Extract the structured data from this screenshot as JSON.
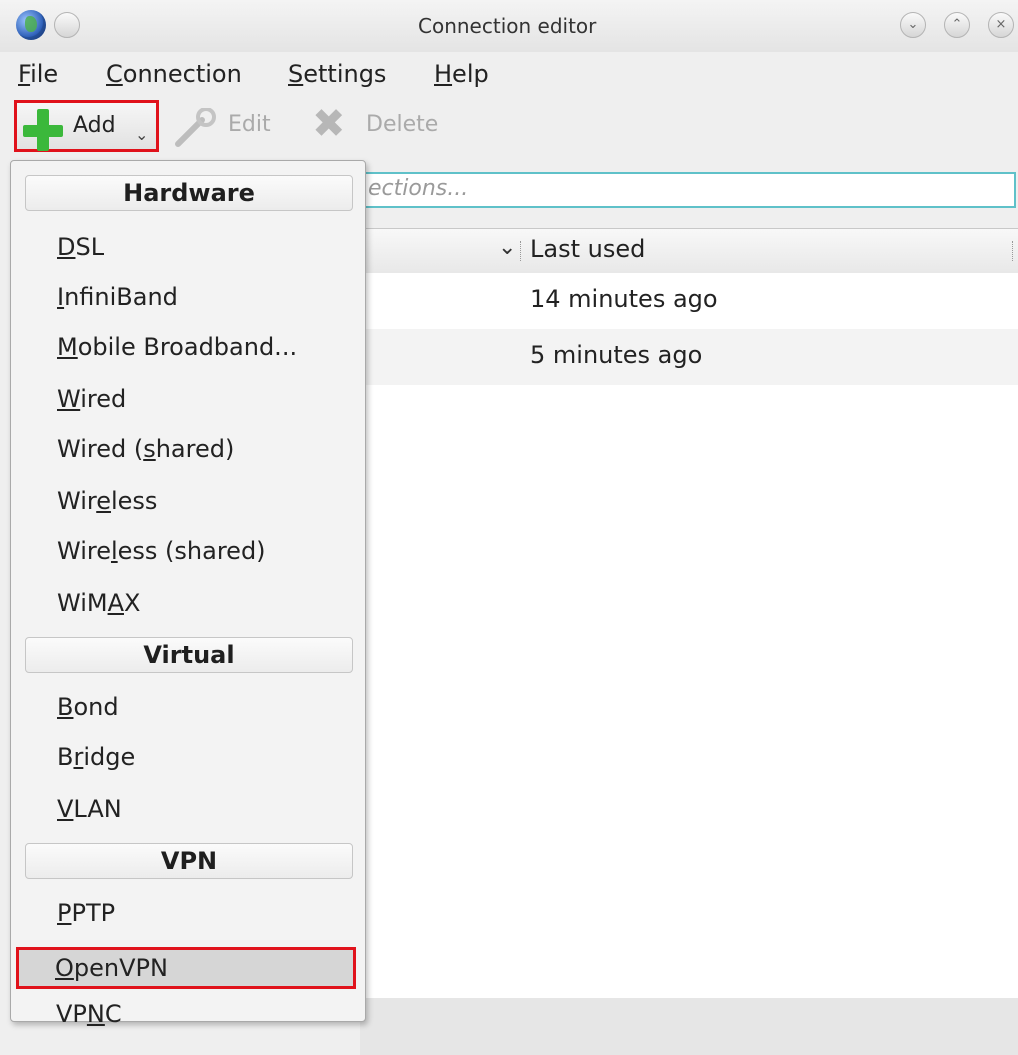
{
  "window": {
    "title": "Connection editor"
  },
  "menubar": {
    "items": [
      {
        "mnemonic": "F",
        "rest": "ile"
      },
      {
        "mnemonic": "C",
        "rest": "onnection"
      },
      {
        "mnemonic": "S",
        "rest": "ettings"
      },
      {
        "mnemonic": "H",
        "rest": "elp"
      }
    ]
  },
  "toolbar": {
    "add_label": "Add",
    "edit_label": "Edit",
    "delete_label": "Delete"
  },
  "search": {
    "placeholder_visible": "ections..."
  },
  "list": {
    "header": "Last used",
    "rows": [
      {
        "last_used": "14 minutes ago"
      },
      {
        "last_used": "5 minutes ago"
      }
    ]
  },
  "dropdown": {
    "sections": [
      "Hardware",
      "Virtual",
      "VPN"
    ],
    "hardware": [
      {
        "pre": "",
        "mn": "D",
        "post": "SL"
      },
      {
        "pre": "",
        "mn": "I",
        "post": "nfiniBand"
      },
      {
        "pre": "",
        "mn": "M",
        "post": "obile Broadband..."
      },
      {
        "pre": "",
        "mn": "W",
        "post": "ired"
      },
      {
        "pre": "Wired (",
        "mn": "s",
        "post": "hared)"
      },
      {
        "pre": "Wir",
        "mn": "e",
        "post": "less"
      },
      {
        "pre": "Wire",
        "mn": "l",
        "post": "ess (shared)"
      },
      {
        "pre": "WiM",
        "mn": "A",
        "post": "X"
      }
    ],
    "virtual": [
      {
        "pre": "",
        "mn": "B",
        "post": "ond"
      },
      {
        "pre": "B",
        "mn": "r",
        "post": "idge"
      },
      {
        "pre": "",
        "mn": "V",
        "post": "LAN"
      }
    ],
    "vpn": [
      {
        "pre": "",
        "mn": "P",
        "post": "PTP"
      },
      {
        "pre": "",
        "mn": "O",
        "post": "penVPN"
      },
      {
        "pre": "VP",
        "mn": "N",
        "post": "C"
      }
    ]
  },
  "colors": {
    "highlight_border": "#e0121b",
    "search_border": "#5fc1c9",
    "add_icon": "#3bb83b"
  }
}
